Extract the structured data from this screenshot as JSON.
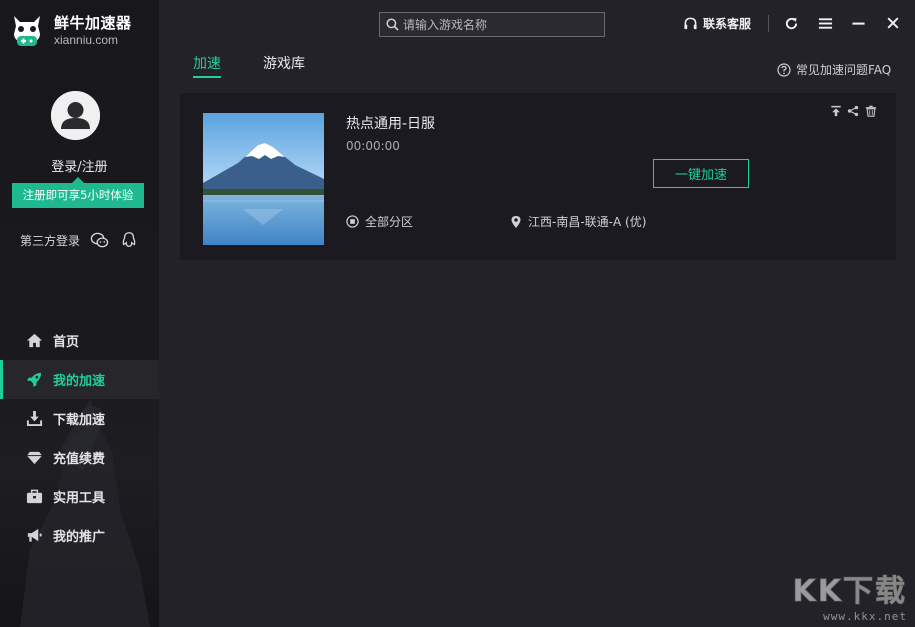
{
  "app": {
    "name": "鲜牛加速器",
    "domain": "xianniu.com"
  },
  "account": {
    "login_label": "登录/注册",
    "trial_text": "注册即可享5小时体验",
    "third_party_label": "第三方登录"
  },
  "nav": {
    "items": [
      {
        "label": "首页",
        "icon": "home-icon"
      },
      {
        "label": "我的加速",
        "icon": "rocket-icon",
        "active": true
      },
      {
        "label": "下载加速",
        "icon": "download-icon"
      },
      {
        "label": "充值续费",
        "icon": "diamond-icon"
      },
      {
        "label": "实用工具",
        "icon": "toolbox-icon"
      },
      {
        "label": "我的推广",
        "icon": "megaphone-icon"
      }
    ]
  },
  "header": {
    "search_placeholder": "请输入游戏名称",
    "support_label": "联系客服"
  },
  "tabs": [
    {
      "label": "加速",
      "active": true
    },
    {
      "label": "游戏库",
      "active": false
    }
  ],
  "faq_label": "常见加速问题FAQ",
  "game_card": {
    "title": "热点通用-日服",
    "timer": "00:00:00",
    "boost_button": "一键加速",
    "region": "全部分区",
    "server": "江西-南昌-联通-A (优)"
  },
  "watermark": {
    "brand": "KK下载",
    "url": "www.kkx.net"
  },
  "colors": {
    "accent": "#1fcf9a",
    "sidebar_bg": "#18181c",
    "main_bg": "#232228",
    "card_bg": "#1b1a20"
  }
}
